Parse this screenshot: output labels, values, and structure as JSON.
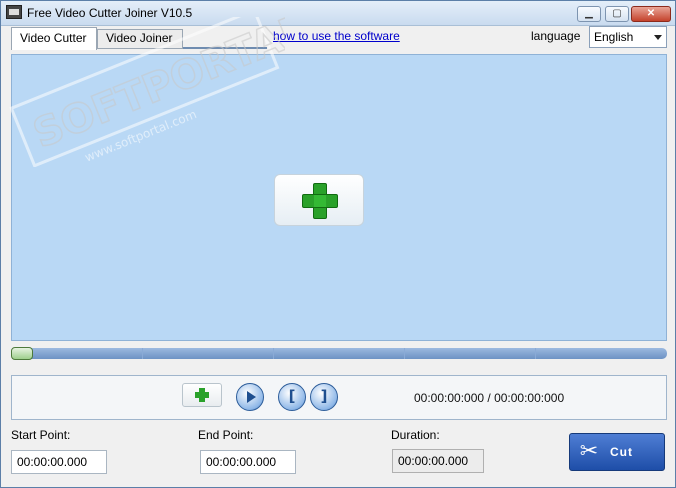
{
  "window": {
    "title": "Free Video Cutter Joiner V10.5",
    "controls": {
      "minimize": "▁",
      "maximize": "▢",
      "close": "✕"
    }
  },
  "tabs": [
    {
      "label": "Video Cutter",
      "active": true
    },
    {
      "label": "Video Joiner",
      "active": false
    }
  ],
  "header": {
    "howto_link": "how to use the software",
    "language_label": "language",
    "language_value": "English"
  },
  "player": {
    "add_icon": "plus-icon",
    "progress_fraction": 0.0
  },
  "controls": {
    "time_display": "00:00:00:000 / 00:00:00:000",
    "set_start_glyph": "[",
    "set_end_glyph": "]"
  },
  "points": {
    "start_label": "Start Point:",
    "start_value": "00:00:00.000",
    "end_label": "End Point:",
    "end_value": "00:00:00.000",
    "duration_label": "Duration:",
    "duration_value": "00:00:00.000"
  },
  "cut_button": {
    "label": "Cut",
    "icon": "scissors-icon"
  },
  "watermark": {
    "text": "SOFTPORTAL",
    "subtext": "www.softportal.com"
  },
  "colors": {
    "video_area": "#b9d8f5",
    "progress": "#6d92c4",
    "cut_button": "#1e4ea8",
    "add_plus": "#2aa12a",
    "link": "#0000cc"
  }
}
